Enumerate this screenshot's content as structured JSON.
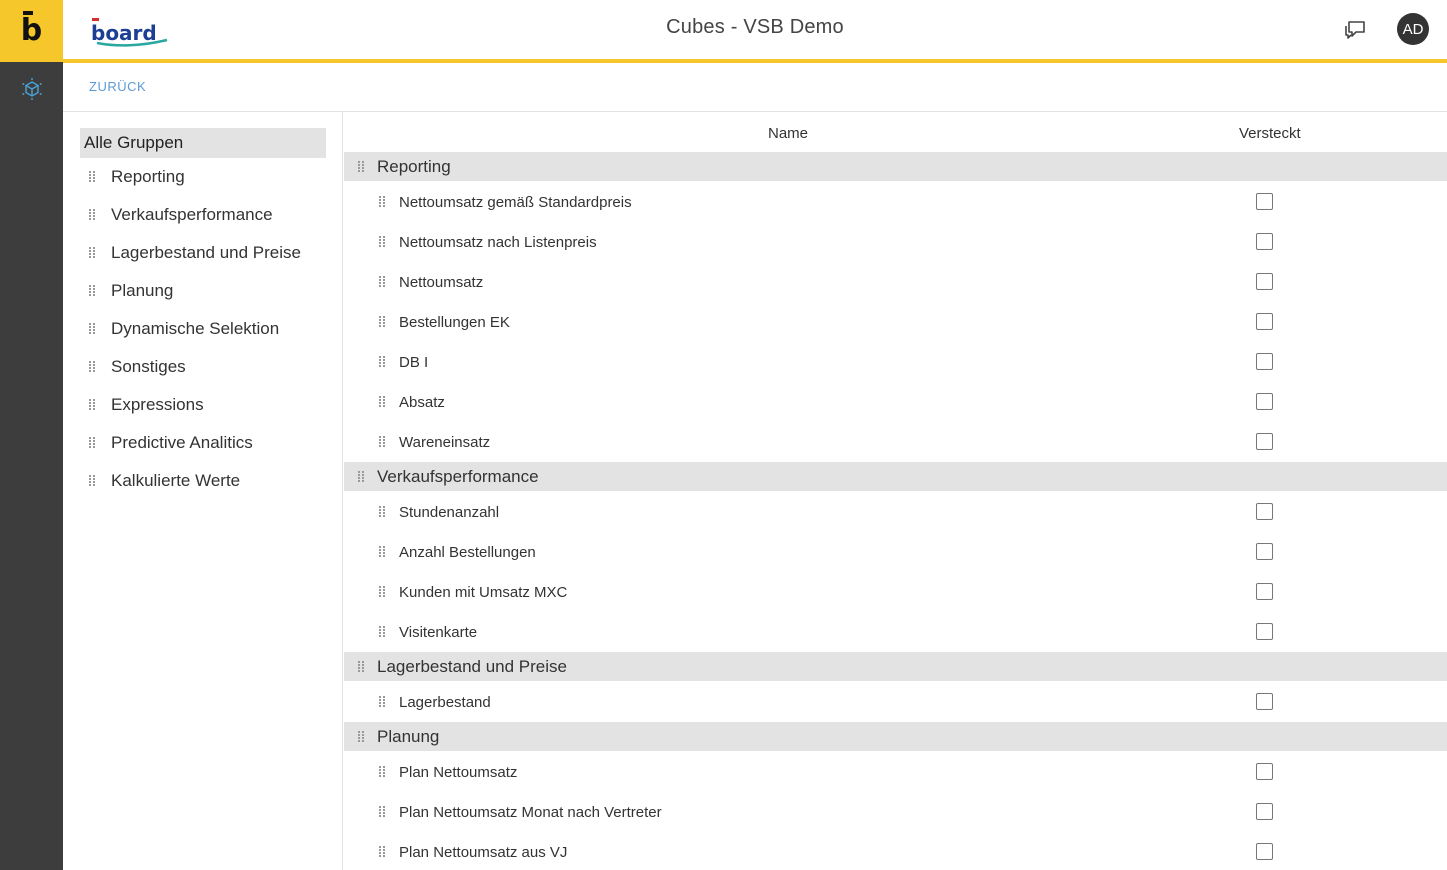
{
  "header": {
    "brand_logo": "board",
    "title": "Cubes - VSB Demo",
    "avatar_initials": "AD",
    "accent_color": "#f6c72a"
  },
  "rail": {
    "logo_letter": "b",
    "items": [
      {
        "icon": "cube-settings-icon"
      }
    ]
  },
  "subbar": {
    "back_label": "ZURÜCK"
  },
  "groups": {
    "all_label": "Alle Gruppen",
    "items": [
      "Reporting",
      "Verkaufsperformance",
      "Lagerbestand und Preise",
      "Planung",
      "Dynamische Selektion",
      "Sonstiges",
      "Expressions",
      "Predictive Analitics",
      "Kalkulierte Werte"
    ]
  },
  "table": {
    "columns": {
      "name": "Name",
      "hidden": "Versteckt"
    },
    "sections": [
      {
        "label": "Reporting",
        "cubes": [
          {
            "name": "Nettoumsatz gemäß Standardpreis",
            "hidden": false
          },
          {
            "name": "Nettoumsatz nach Listenpreis",
            "hidden": false
          },
          {
            "name": "Nettoumsatz",
            "hidden": false
          },
          {
            "name": "Bestellungen EK",
            "hidden": false
          },
          {
            "name": "DB I",
            "hidden": false
          },
          {
            "name": "Absatz",
            "hidden": false
          },
          {
            "name": "Wareneinsatz",
            "hidden": false
          }
        ]
      },
      {
        "label": "Verkaufsperformance",
        "cubes": [
          {
            "name": "Stundenanzahl",
            "hidden": false
          },
          {
            "name": "Anzahl Bestellungen",
            "hidden": false
          },
          {
            "name": "Kunden mit Umsatz MXC",
            "hidden": false
          },
          {
            "name": "Visitenkarte",
            "hidden": false
          }
        ]
      },
      {
        "label": "Lagerbestand und Preise",
        "cubes": [
          {
            "name": "Lagerbestand",
            "hidden": false
          }
        ]
      },
      {
        "label": "Planung",
        "cubes": [
          {
            "name": "Plan Nettoumsatz",
            "hidden": false
          },
          {
            "name": "Plan Nettoumsatz Monat nach Vertreter",
            "hidden": false
          },
          {
            "name": "Plan Nettoumsatz aus VJ",
            "hidden": false
          }
        ]
      }
    ]
  }
}
